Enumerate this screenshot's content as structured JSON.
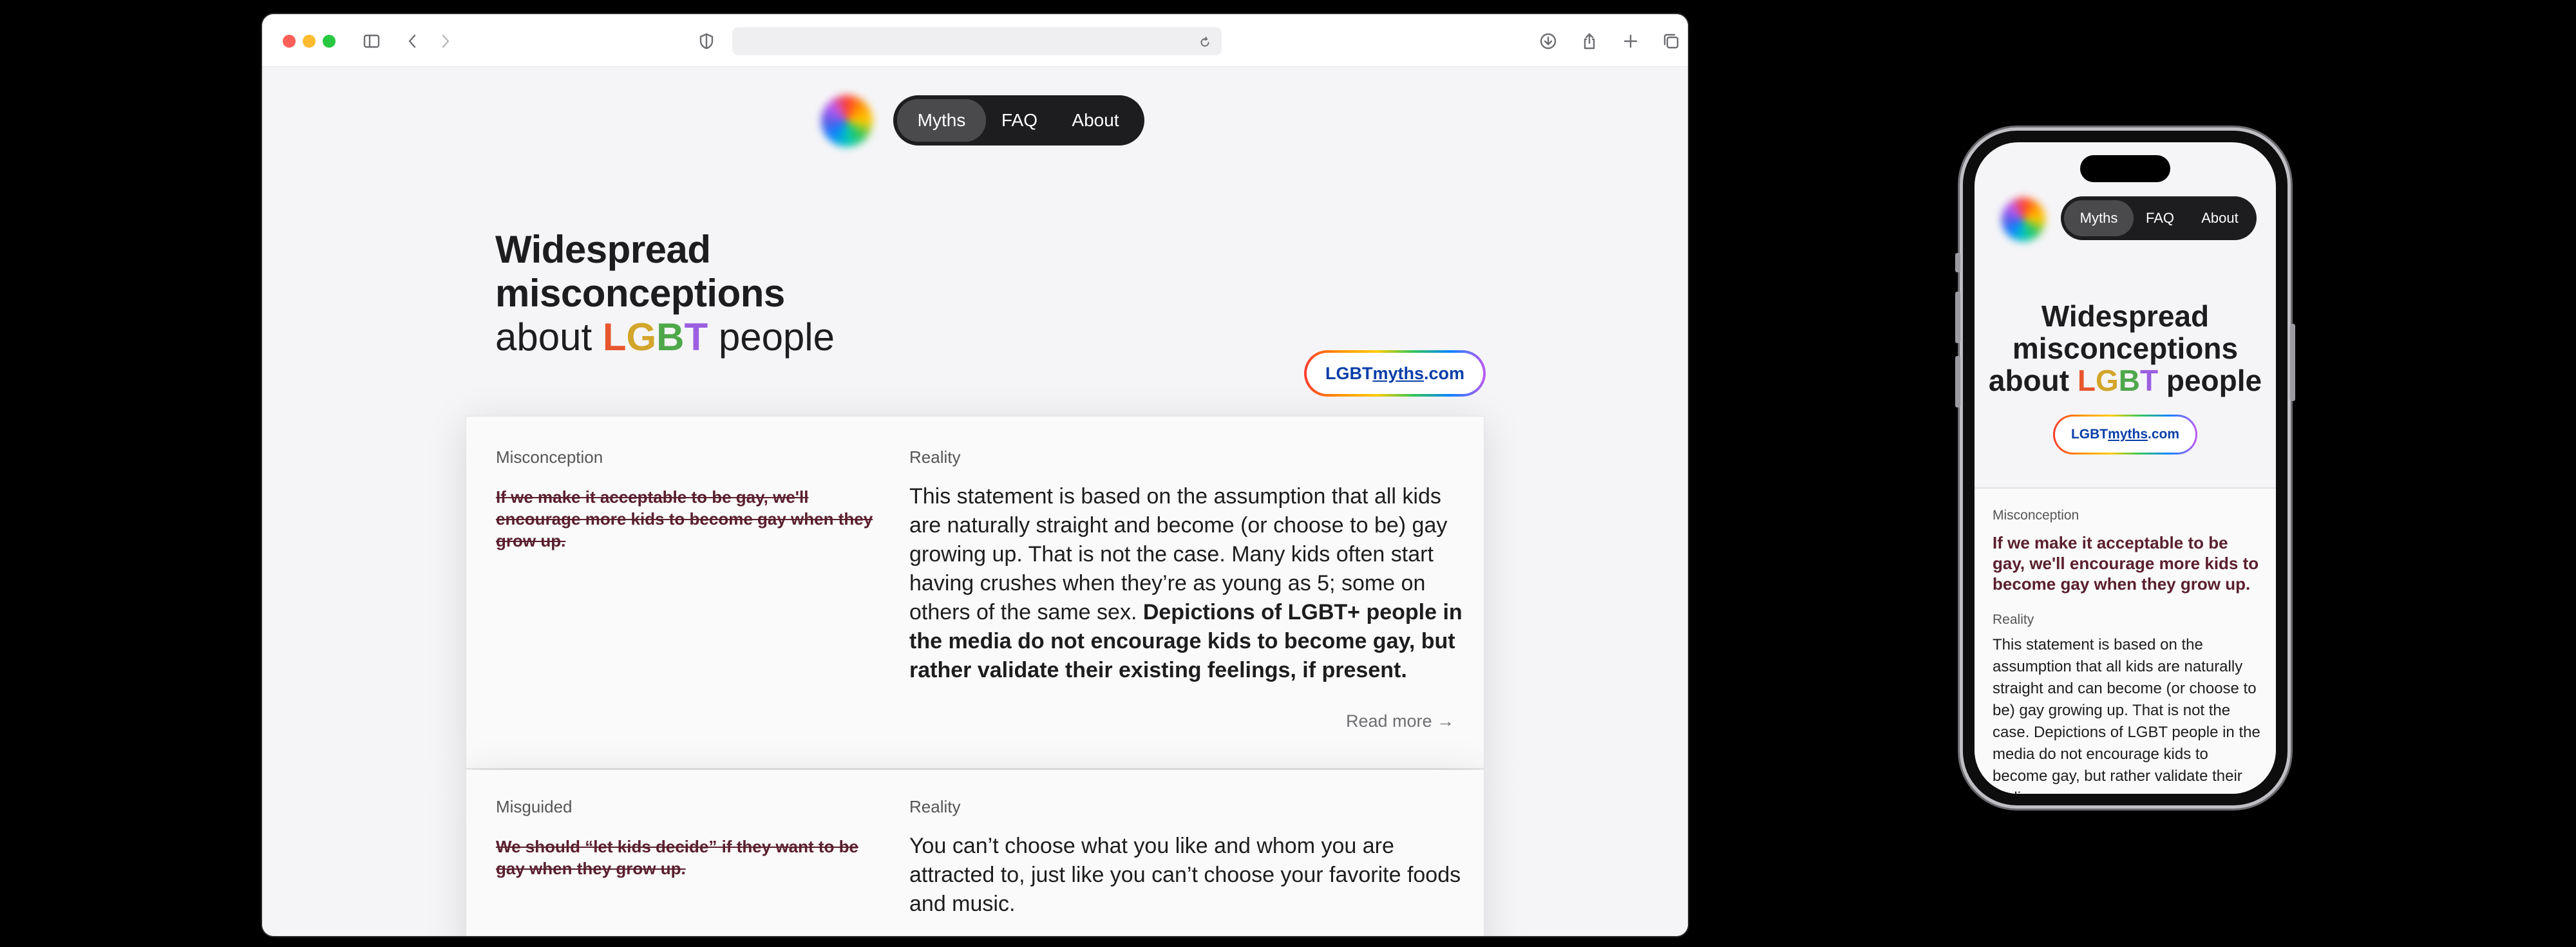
{
  "browser": {
    "address_value": "",
    "nav": {
      "items": [
        "Myths",
        "FAQ",
        "About"
      ],
      "active": "Myths"
    },
    "hero": {
      "line1": "Widespread",
      "line2": "misconceptions",
      "line3_pre": "about ",
      "letters": [
        "L",
        "G",
        "B",
        "T"
      ],
      "line3_post": " people"
    },
    "domain": {
      "pre": "LGBT",
      "mid": "myths",
      "post": ".com"
    },
    "cards": [
      {
        "label_left": "Misconception",
        "label_right": "Reality",
        "myth": "If we make it acceptable to be gay, we'll encourage more kids to become gay when they grow up.",
        "reality_text": "This statement is based on the assumption that all kids are naturally straight and become (or choose to be) gay growing up. That is not the case. Many kids often start having crushes when they’re as young as 5; some on others of the same sex. ",
        "reality_bold": "Depictions of LGBT+ people in the media do not encourage kids to become gay, but rather validate their existing feelings, if present.",
        "read_more": "Read more →"
      },
      {
        "label_left": "Misguided",
        "label_right": "Reality",
        "myth": "We should “let kids decide” if they want to be gay when they grow up.",
        "reality_text": "You can’t choose what you like and whom you are attracted to, just like you can’t choose your favorite foods and music."
      }
    ]
  },
  "phone": {
    "nav": {
      "items": [
        "Myths",
        "FAQ",
        "About"
      ],
      "active": "Myths"
    },
    "hero": {
      "line1": "Widespread",
      "line2": "misconceptions",
      "line3_pre": "about ",
      "letters": [
        "L",
        "G",
        "B",
        "T"
      ],
      "line3_post": " people"
    },
    "domain": {
      "pre": "LGBT",
      "mid": "myths",
      "post": ".com"
    },
    "card": {
      "label_myth": "Misconception",
      "myth": "If we make it acceptable to be gay, we'll encourage more kids to become gay when they grow up.",
      "label_reality": "Reality",
      "reality_text": "This statement is based on the assumption that all kids are naturally straight and can become (or choose to be) gay growing up. That is not the case. Depictions of LGBT people in the media do not encourage kids to become gay, but rather validate their feelings."
    }
  },
  "colors": {
    "accent_link": "#0a3ea8",
    "myth_text": "#5a1f2e",
    "nav_bg": "#1d1d1f",
    "nav_active": "#4a4a4d"
  },
  "icons": [
    "sidebar-icon",
    "back-icon",
    "forward-icon",
    "shield-icon",
    "reload-icon",
    "download-icon",
    "share-icon",
    "new-tab-icon",
    "tabs-overview-icon"
  ]
}
